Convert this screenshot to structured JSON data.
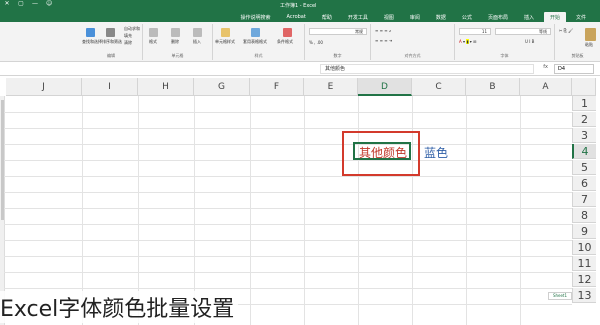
{
  "window": {
    "title": "工作簿1 - Excel",
    "controls": [
      "✕",
      "▢",
      "—",
      "☺"
    ]
  },
  "tabs": [
    "文件",
    "开始",
    "插入",
    "页面布局",
    "公式",
    "数据",
    "审阅",
    "视图",
    "开发工具",
    "帮助",
    "Acrobat",
    "操作说明搜索"
  ],
  "active_tab_index": 1,
  "ribbon": {
    "groups": [
      {
        "label": "剪贴板"
      },
      {
        "label": "字体"
      },
      {
        "label": "对齐方式"
      },
      {
        "label": "数字"
      },
      {
        "label": "样式"
      },
      {
        "label": "单元格"
      },
      {
        "label": "编辑"
      }
    ],
    "font_name": "等线",
    "font_size": "11",
    "number_format": "常规",
    "items": {
      "paste": "粘贴",
      "cond_format": "条件格式",
      "table_format": "套用表格格式",
      "cell_style": "单元格样式",
      "insert": "插入",
      "delete": "删除",
      "format": "格式",
      "autosum": "自动求和",
      "fill": "填充",
      "clear": "清除",
      "sort_filter": "排序和筛选",
      "find_select": "查找和选择"
    }
  },
  "formula_bar": {
    "name_box": "D4",
    "fx": "fx",
    "content": "其他颜色"
  },
  "columns": [
    "A",
    "B",
    "C",
    "D",
    "E",
    "F",
    "G",
    "H",
    "I",
    "J"
  ],
  "selected_column": "D",
  "rows": [
    "1",
    "2",
    "3",
    "4",
    "5",
    "6",
    "7",
    "8",
    "9",
    "10",
    "11",
    "12",
    "13"
  ],
  "selected_row": "4",
  "cells": {
    "C4": {
      "text": "蓝色",
      "color": "#2f5fa7"
    },
    "D4": {
      "text": "其他颜色",
      "color": "#c0392b"
    }
  },
  "sheet_tab": "Sheet1",
  "caption": "Excel字体颜色批量设置",
  "colors": {
    "accent": "#217346",
    "highlight": "#d33a2c"
  }
}
